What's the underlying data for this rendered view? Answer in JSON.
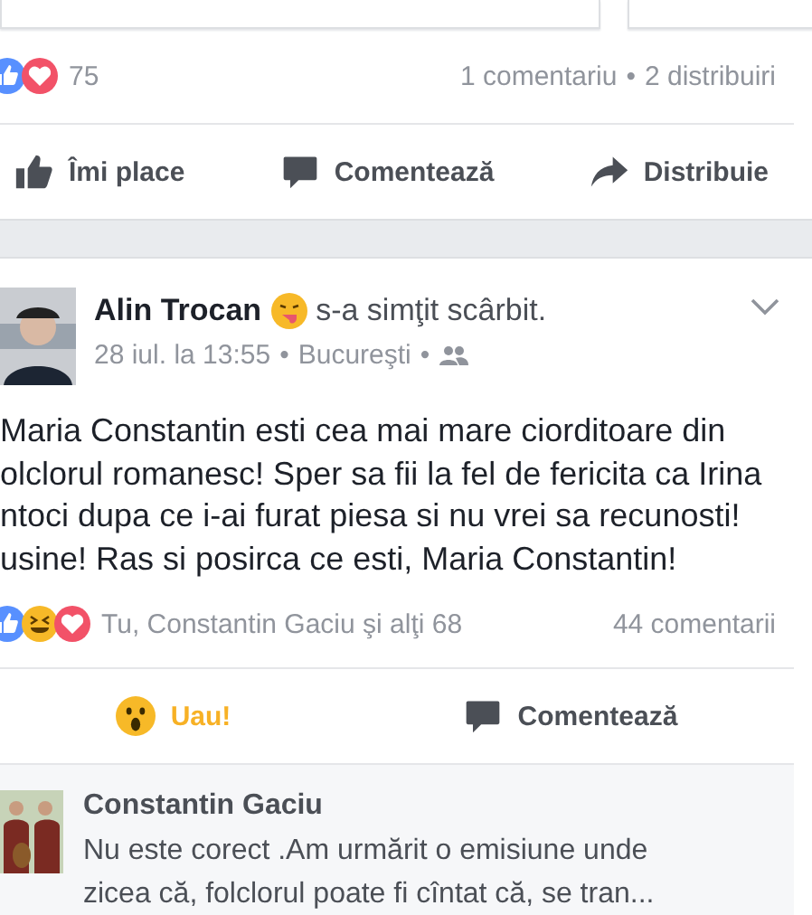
{
  "previous_post": {
    "reaction_count": "75",
    "comments": "1 comentariu",
    "shares": "2 distribuiri",
    "separator": "•",
    "actions": [
      {
        "kind": "like",
        "label": "Îmi place"
      },
      {
        "kind": "comment",
        "label": "Comentează"
      },
      {
        "kind": "share",
        "label": "Distribuie"
      }
    ]
  },
  "post": {
    "author": "Alin Trocan",
    "feeling": "s-a simţit scârbit.",
    "date": "28 iul. la 13:55",
    "location": "Bucureşti",
    "separators": [
      "•",
      "•"
    ],
    "text": [
      "Maria Constantin esti cea mai mare ciorditoare din",
      "olclorul romanesc! Sper sa fii la fel de fericita ca Irina",
      "ntoci dupa ce i-ai furat piesa si nu vrei sa recunosti!",
      "usine! Ras si posirca ce esti, Maria Constantin!"
    ],
    "reactions_text": "Tu, Constantin Gaciu şi alţi 68",
    "comments": "44 comentarii",
    "actions": [
      {
        "kind": "wow",
        "label": "Uau!",
        "selected": true
      },
      {
        "kind": "comment",
        "label": "Comentează",
        "selected": false
      }
    ]
  },
  "comment": {
    "author": "Constantin Gaciu",
    "text": [
      "Nu este corect .Am urmărit o emisiune unde",
      "zicea că, folclorul poate fi cîntat că, se tran..."
    ]
  }
}
